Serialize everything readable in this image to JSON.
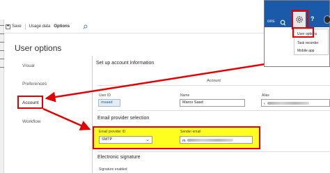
{
  "toolbar": {
    "save_label": "Save",
    "usage_label": "Usage data",
    "options_label": "Options"
  },
  "page": {
    "title": "User options"
  },
  "tabs": [
    "Visual",
    "Preferences",
    "Account",
    "Workflow"
  ],
  "section": {
    "title": "Set up account information",
    "account_header": "Account",
    "user_id_label": "User ID",
    "user_id_value": "msaad",
    "name_label": "Name",
    "name_value": "Marco Saad",
    "alias_label": "Alias",
    "alias_value": "‹"
  },
  "email": {
    "title": "Email provider selection",
    "provider_label": "Email provider ID",
    "provider_value": "SMTP",
    "sender_label": "Sender email",
    "sender_value": "m"
  },
  "signature": {
    "title": "Electronic signature",
    "enabled_label": "Signature enabled"
  },
  "inset": {
    "brand": "ons",
    "menu": [
      "User options",
      "Task recorder",
      "Mobile app"
    ]
  },
  "colors": {
    "highlight_border": "#e10000",
    "highlight_fill": "#ffff1f",
    "header_blue": "#1a5aa8"
  }
}
